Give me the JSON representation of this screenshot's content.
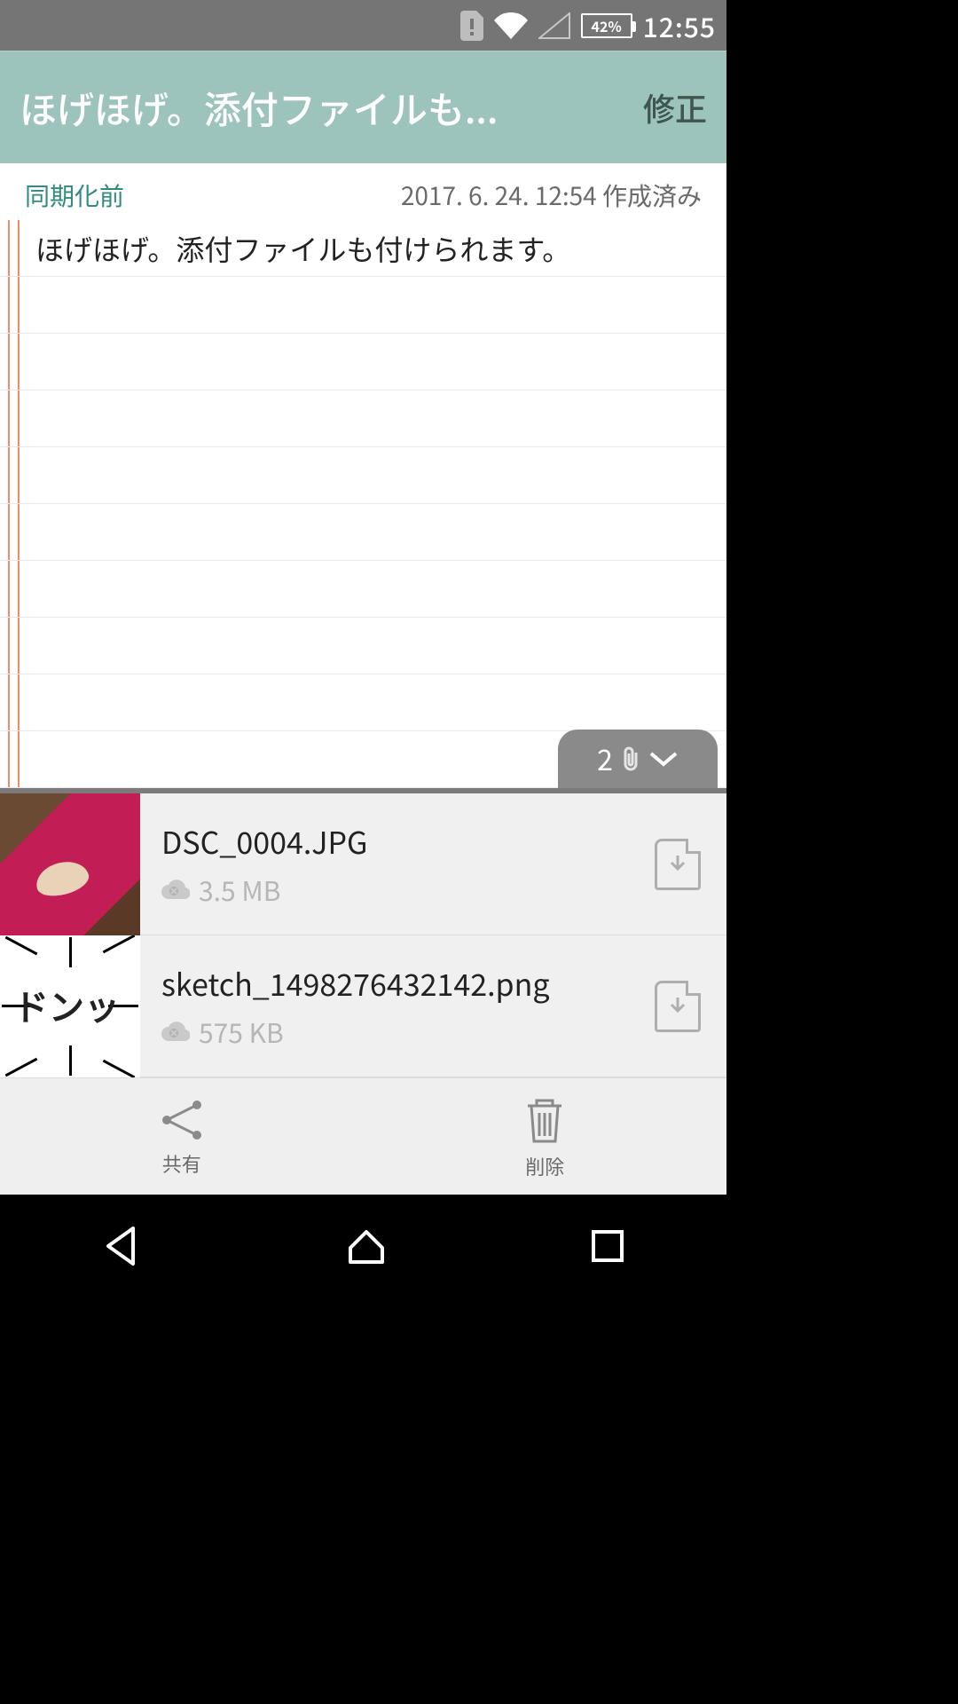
{
  "status": {
    "battery": "42%",
    "time": "12:55"
  },
  "appbar": {
    "title": "ほげほげ。添付ファイルも...",
    "edit": "修正"
  },
  "meta": {
    "sync": "同期化前",
    "created": "2017. 6. 24. 12:54 作成済み"
  },
  "note": {
    "body": "ほげほげ。添付ファイルも付けられます。"
  },
  "attach_tab": {
    "count": "2"
  },
  "attachments": [
    {
      "name": "DSC_0004.JPG",
      "size": "3.5 MB",
      "thumb_text": ""
    },
    {
      "name": "sketch_1498276432142.png",
      "size": "575 KB",
      "thumb_text": "ドンッ"
    }
  ],
  "actions": {
    "share": "共有",
    "delete": "削除"
  }
}
